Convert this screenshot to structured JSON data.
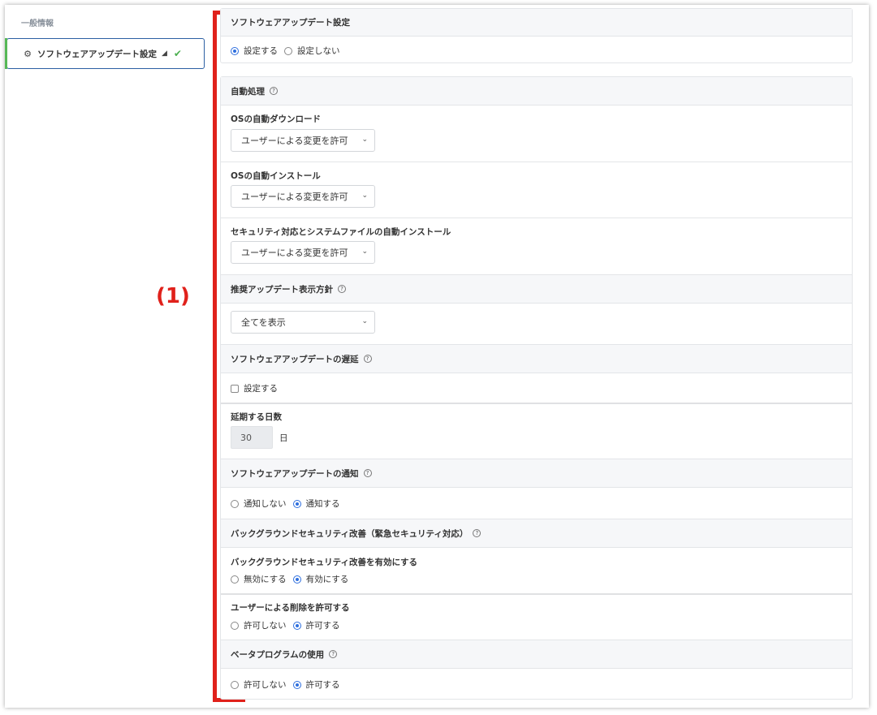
{
  "sidebar": {
    "title": "一般情報",
    "active_item": {
      "label": "ソフトウェアアップデート設定"
    }
  },
  "annotation": "(1)",
  "software_update": {
    "title": "ソフトウェアアップデート設定",
    "options": [
      "設定する",
      "設定しない"
    ],
    "selected": "設定する"
  },
  "auto_processing": {
    "title": "自動処理",
    "os_download": {
      "label": "OSの自動ダウンロード",
      "value": "ユーザーによる変更を許可"
    },
    "os_install": {
      "label": "OSの自動インストール",
      "value": "ユーザーによる変更を許可"
    },
    "security_install": {
      "label": "セキュリティ対応とシステムファイルの自動インストール",
      "value": "ユーザーによる変更を許可"
    }
  },
  "recommended": {
    "title": "推奨アップデート表示方針",
    "value": "全てを表示"
  },
  "delay": {
    "title": "ソフトウェアアップデートの遅延",
    "checkbox_label": "設定する",
    "days_label": "延期する日数",
    "days_value": "30",
    "days_unit": "日"
  },
  "notify": {
    "title": "ソフトウェアアップデートの通知",
    "options": [
      "通知しない",
      "通知する"
    ],
    "selected": "通知する"
  },
  "background": {
    "title": "バックグラウンドセキュリティ改善（緊急セキュリティ対応）",
    "enable": {
      "label": "バックグラウンドセキュリティ改善を有効にする",
      "options": [
        "無効にする",
        "有効にする"
      ],
      "selected": "有効にする"
    },
    "allow_delete": {
      "label": "ユーザーによる削除を許可する",
      "options": [
        "許可しない",
        "許可する"
      ],
      "selected": "許可する"
    }
  },
  "beta": {
    "title": "ベータプログラムの使用",
    "options": [
      "許可しない",
      "許可する"
    ],
    "selected": "許可する"
  },
  "colors": {
    "accent": "#2f6fde",
    "annotation": "#e0211b",
    "active_border": "#2c5fa3",
    "success": "#4caf50"
  }
}
